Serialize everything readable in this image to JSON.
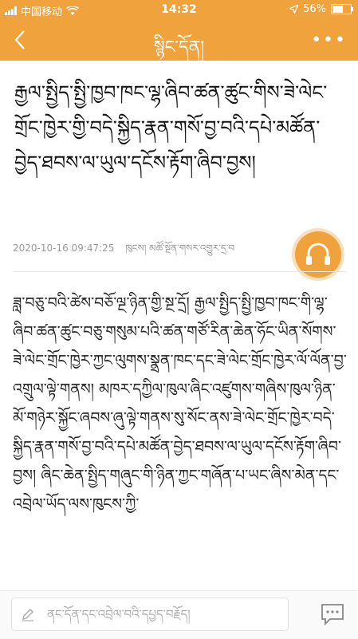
{
  "status": {
    "carrier": "中国移动",
    "time": "14:32",
    "battery": "56%",
    "battery_level": 0.56
  },
  "nav": {
    "title": "སྙིང་དོན།",
    "more_label": "•••"
  },
  "article": {
    "title": "རྒྱལ་སྤྱིད་སྤྱི་ཁྱབ་ཁང་ལྷ་ཞིབ་ཚན་ཚུང་གིས་ཟེ་ལེང་གྲོང་ཁྱེར་གྱི་བདེ་སྐྱིད་རྣན་གསོ་བྱ་བའི་དཔེ་མཚོན་བྱེད་ཐབས་ལ་ཡུལ་དངོས་རྟོག་ཞིབ་བྱས།",
    "date": "2020-10-16 09:47:25",
    "source": "ཁུངས། མཚོ་སྔོན་གསར་འགྱུར་དྲ་བ",
    "body": "ཟླ་བཅུ་བའི་ཚེས་བཅོ་ལྔ་ཉིན་གྱི་སྔ་དྲོ། རྒྱལ་སྤྱིད་སྤྱི་ཁྱབ་ཁང་གི་ལྷ་ཞིབ་ཚན་ཚུང་བཅུ་གསུམ་པའི་ཚན་གཙོ་རིན་ཆེན་ཧོང་ཡིན་སོགས་ཟེ་ལེང་གྲོང་ཁྱེར་ཀྱང་ལུགས་སྣྲན་ཁང་དང་ཟེ་ལེང་གྲོང་ཁྱེར་ལོ་ལོན་བྱ་འགྲུལ་ལྟེ་གནས། མཁར་དཀྱིལ་ཁུལ་ཞིང་འཛུགས་གཞིས་ཁུལ་ཉིན་མོ་གཉེར་སྐྱོང་ཞབས་ཞུ་ལྟེ་གནས་སུ་སོང་ནས་ཟེ་ལེང་གྲོང་ཁྱེར་བདེ་སྐྱིད་རྣན་གསོ་བྱ་བའི་དཔེ་མཚོན་བྱེད་ཐབས་ལ་ཡུལ་དངོས་རྟོག་ཞིབ་བྱས། ཞིང་ཆེན་སྤྱིད་གཞུང་གི་ཉིན་ཀྱང་གཞོན་པ་ཡང་ཞིས་མེན་དང་འབྲེལ་ཡོད་ལས་ཁུངས་ཀྱི་"
  },
  "comment": {
    "placeholder": "ནང་དོན་དང་འབྲེལ་བའི་དཔྱད་བརྗོད།"
  }
}
